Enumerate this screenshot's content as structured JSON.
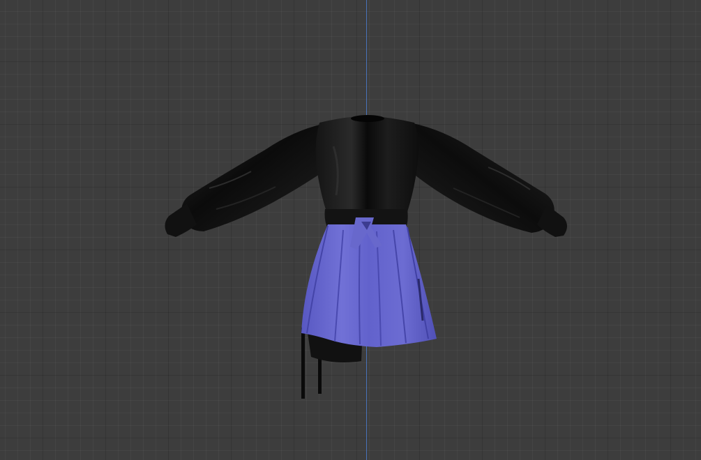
{
  "viewport": {
    "background_color": "#3d3d3d",
    "axis_color": "#4a79c8"
  },
  "model": {
    "top_color": "#0d0d0d",
    "skirt_color": "#6a6ad0"
  }
}
